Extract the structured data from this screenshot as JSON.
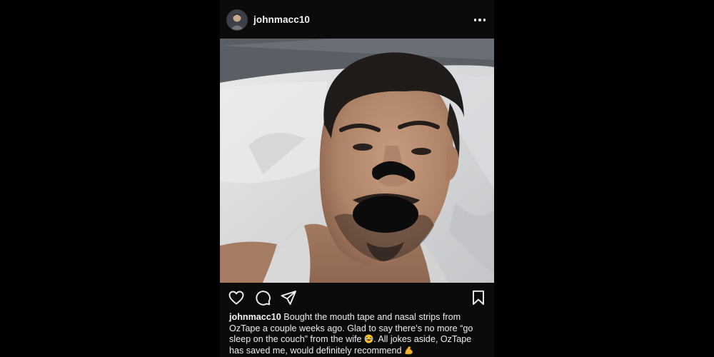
{
  "post": {
    "username": "johnmacc10",
    "more_icon": "more-horizontal-icon",
    "actions": {
      "like_icon": "heart-icon",
      "comment_icon": "comment-icon",
      "share_icon": "send-icon",
      "save_icon": "bookmark-icon"
    },
    "caption": {
      "username": "johnmacc10",
      "text_part1": "Bought the mouth tape and nasal strips from OzTape a couple weeks ago. Glad to say there’s no more “go sleep on the couch” from the wife",
      "emoji_1": "laughing-tears-emoji",
      "text_part2": ". All jokes aside, OzTape has saved me, would definitely recommend",
      "emoji_2": "flexed-biceps-emoji"
    }
  },
  "colors": {
    "background": "#000000",
    "post_background": "#0b0b0c",
    "text": "#ececec",
    "icon": "#f0f0f0"
  }
}
